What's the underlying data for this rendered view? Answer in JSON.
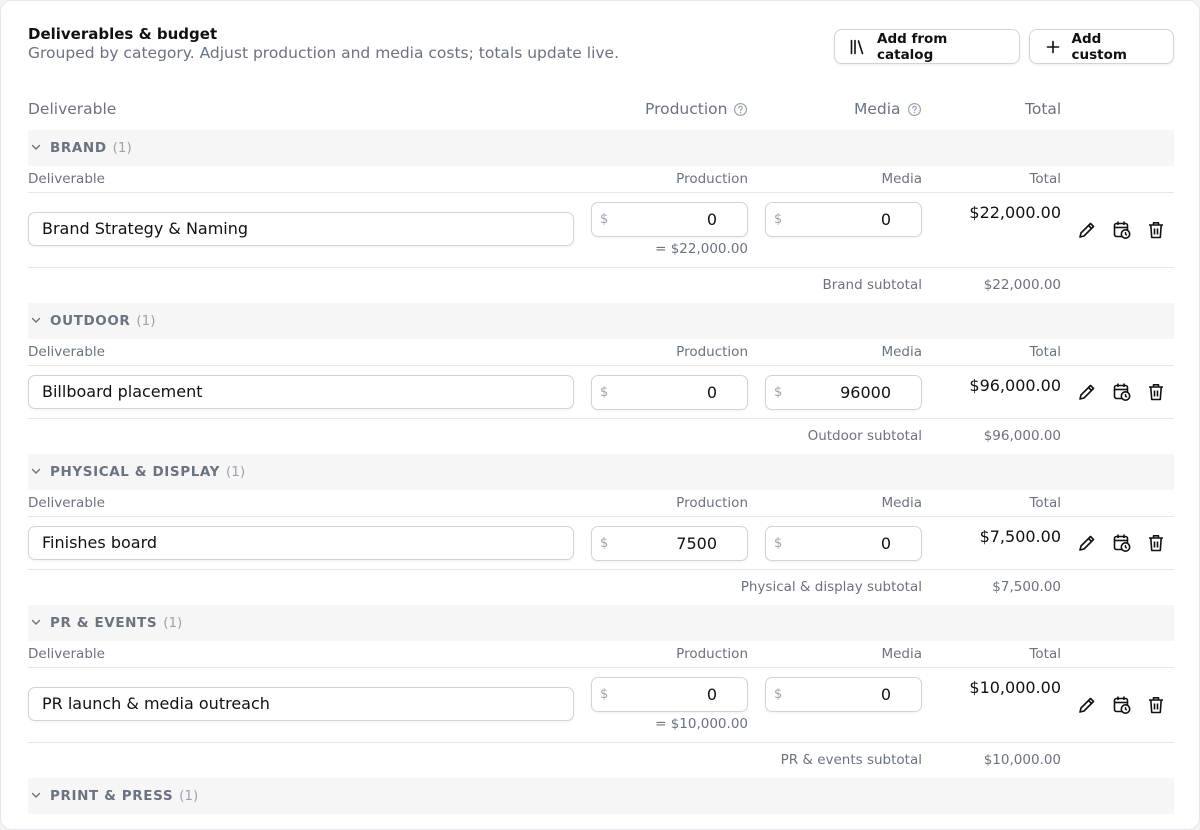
{
  "header": {
    "title": "Deliverables & budget",
    "subtitle": "Grouped by category. Adjust production and media costs; totals update live.",
    "add_catalog_label": "Add from catalog",
    "add_custom_label": "Add custom"
  },
  "columns": {
    "deliverable": "Deliverable",
    "production": "Production",
    "media": "Media",
    "total": "Total"
  },
  "currency_symbol": "$",
  "groups": [
    {
      "name": "BRAND",
      "count": "(1)",
      "sub_deliverable": "Deliverable",
      "sub_production": "Production",
      "sub_media": "Media",
      "sub_total": "Total",
      "item": {
        "name": "Brand Strategy & Naming",
        "production": "0",
        "media": "0",
        "total": "$22,000.00",
        "note": "= $22,000.00"
      },
      "subtotal_label": "Brand subtotal",
      "subtotal_value": "$22,000.00"
    },
    {
      "name": "OUTDOOR",
      "count": "(1)",
      "sub_deliverable": "Deliverable",
      "sub_production": "Production",
      "sub_media": "Media",
      "sub_total": "Total",
      "item": {
        "name": "Billboard placement",
        "production": "0",
        "media": "96000",
        "total": "$96,000.00"
      },
      "subtotal_label": "Outdoor subtotal",
      "subtotal_value": "$96,000.00"
    },
    {
      "name": "PHYSICAL & DISPLAY",
      "count": "(1)",
      "sub_deliverable": "Deliverable",
      "sub_production": "Production",
      "sub_media": "Media",
      "sub_total": "Total",
      "item": {
        "name": "Finishes board",
        "production": "7500",
        "media": "0",
        "total": "$7,500.00"
      },
      "subtotal_label": "Physical & display subtotal",
      "subtotal_value": "$7,500.00"
    },
    {
      "name": "PR & EVENTS",
      "count": "(1)",
      "sub_deliverable": "Deliverable",
      "sub_production": "Production",
      "sub_media": "Media",
      "sub_total": "Total",
      "item": {
        "name": "PR launch & media outreach",
        "production": "0",
        "media": "0",
        "total": "$10,000.00",
        "note": "= $10,000.00"
      },
      "subtotal_label": "PR & events subtotal",
      "subtotal_value": "$10,000.00"
    },
    {
      "name": "PRINT & PRESS",
      "count": "(1)"
    }
  ],
  "icons": {
    "catalog": "books-icon",
    "add": "plus-icon",
    "help": "question-circle-icon",
    "collapse": "chevron-down-icon",
    "edit": "pencil-icon",
    "schedule": "calendar-clock-icon",
    "delete": "trash-icon"
  }
}
